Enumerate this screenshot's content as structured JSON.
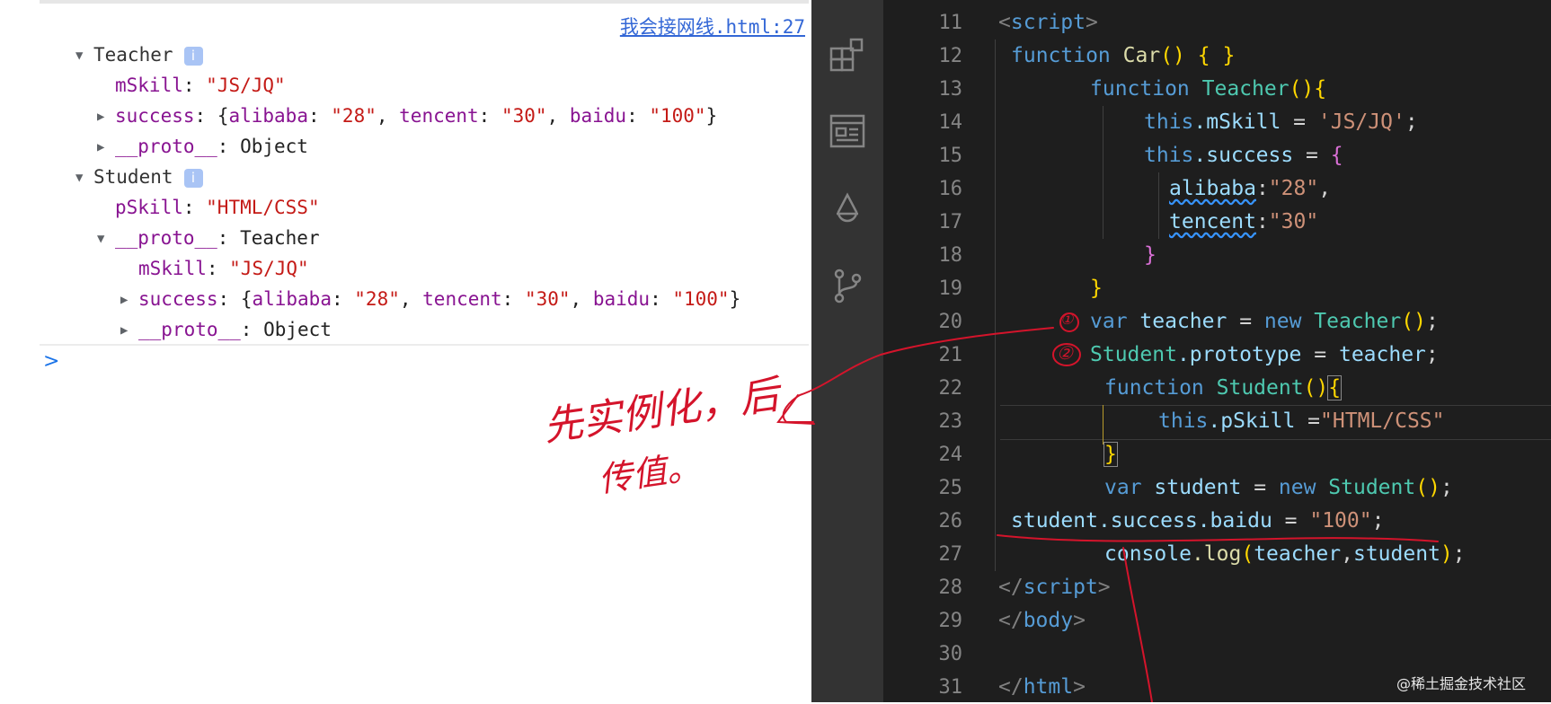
{
  "console": {
    "source_link": "我会接网线.html:27",
    "teacher": {
      "name": "Teacher",
      "info": "i",
      "mskill_key": "mSkill",
      "mskill_value": "\"JS/JQ\"",
      "success_key": "success",
      "success_preview": "{alibaba: \"28\", tencent: \"30\", baidu: \"100\"}",
      "proto_key": "__proto__",
      "proto_value": "Object"
    },
    "student": {
      "name": "Student",
      "info": "i",
      "pskill_key": "pSkill",
      "pskill_value": "\"HTML/CSS\"",
      "proto_key": "__proto__",
      "proto_value": "Teacher",
      "nested_mskill_key": "mSkill",
      "nested_mskill_value": "\"JS/JQ\"",
      "nested_success_key": "success",
      "nested_success_preview": "{alibaba: \"28\", tencent: \"30\", baidu: \"100\"}",
      "nested_proto_key": "__proto__",
      "nested_proto_value": "Object"
    },
    "prompt": ">"
  },
  "editor": {
    "line_numbers": [
      "11",
      "12",
      "13",
      "14",
      "15",
      "16",
      "17",
      "18",
      "19",
      "20",
      "21",
      "22",
      "23",
      "24",
      "25",
      "26",
      "27",
      "28",
      "29",
      "30",
      "31"
    ],
    "code": {
      "l11_open": "<",
      "l11_tag": "script",
      "l11_close": ">",
      "l12_kw": "function",
      "l12_fn": "Car",
      "l12_paren": "()",
      "l12_b1": "{",
      "l12_b2": "}",
      "l13_kw": "function",
      "l13_cls": "Teacher",
      "l13_paren": "()",
      "l13_b": "{",
      "l14_this": "this",
      "l14_prop": ".mSkill",
      "l14_eq": " = ",
      "l14_str": "'JS/JQ'",
      "l14_semi": ";",
      "l15_this": "this",
      "l15_prop": ".success",
      "l15_eq": " = ",
      "l15_b": "{",
      "l16_key": "alibaba",
      "l16_colon": ":",
      "l16_str": "\"28\"",
      "l16_comma": ",",
      "l17_key": "tencent",
      "l17_colon": ":",
      "l17_str": "\"30\"",
      "l18_b": "}",
      "l19_b": "}",
      "l20_kw": "var",
      "l20_var": "teacher",
      "l20_eq": " = ",
      "l20_new": "new",
      "l20_cls": "Teacher",
      "l20_paren": "()",
      "l20_semi": ";",
      "l21_cls": "Student",
      "l21_prop": ".prototype",
      "l21_eq": " = ",
      "l21_var": "teacher",
      "l21_semi": ";",
      "l22_kw": "function",
      "l22_cls": "Student",
      "l22_paren": "()",
      "l22_b": "{",
      "l23_this": "this",
      "l23_prop": ".pSkill",
      "l23_eq": " =",
      "l23_str": "\"HTML/CSS\"",
      "l24_b": "}",
      "l25_kw": "var",
      "l25_var": "student",
      "l25_eq": " = ",
      "l25_new": "new",
      "l25_cls": "Student",
      "l25_paren": "()",
      "l25_semi": ";",
      "l26_var": "student",
      "l26_prop": ".success.baidu",
      "l26_eq": " = ",
      "l26_str": "\"100\"",
      "l26_semi": ";",
      "l27_obj": "console",
      "l27_fn": ".log",
      "l27_p1": "(",
      "l27_a1": "teacher",
      "l27_comma": ",",
      "l27_a2": "student",
      "l27_p2": ")",
      "l27_semi": ";",
      "l28_open": "</",
      "l28_tag": "script",
      "l28_close": ">",
      "l29_open": "</",
      "l29_tag": "body",
      "l29_close": ">",
      "l31_open": "</",
      "l31_tag": "html",
      "l31_close": ">"
    },
    "watermark": "@稀土掘金技术社区"
  },
  "annotations": {
    "marker1": "①",
    "marker2": "②",
    "note_line1": "先实例化，后",
    "note_line2": "传值。",
    "color": "#d4142b"
  },
  "activity_bar": {
    "icons": [
      "extensions-icon",
      "preview-icon",
      "debug-icon",
      "source-control-icon"
    ]
  }
}
